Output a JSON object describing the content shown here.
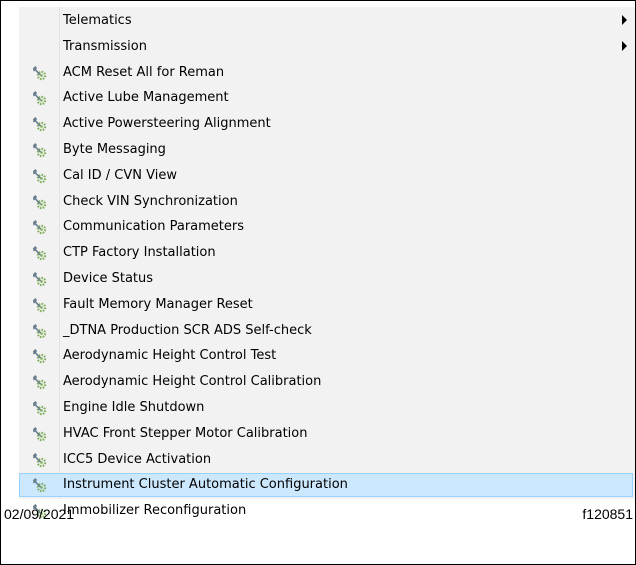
{
  "menu": {
    "items": [
      {
        "label": "Telematics",
        "has_submenu": true,
        "icon": "none",
        "selected": false
      },
      {
        "label": "Transmission",
        "has_submenu": true,
        "icon": "none",
        "selected": false
      },
      {
        "label": "ACM Reset All for Reman",
        "has_submenu": false,
        "icon": "wrench-gear-icon",
        "selected": false
      },
      {
        "label": "Active Lube Management",
        "has_submenu": false,
        "icon": "wrench-gear-icon",
        "selected": false
      },
      {
        "label": "Active Powersteering Alignment",
        "has_submenu": false,
        "icon": "wrench-gear-icon",
        "selected": false
      },
      {
        "label": "Byte Messaging",
        "has_submenu": false,
        "icon": "wrench-gear-icon",
        "selected": false
      },
      {
        "label": "Cal ID / CVN View",
        "has_submenu": false,
        "icon": "wrench-gear-icon",
        "selected": false
      },
      {
        "label": "Check VIN Synchronization",
        "has_submenu": false,
        "icon": "wrench-gear-icon",
        "selected": false
      },
      {
        "label": "Communication Parameters",
        "has_submenu": false,
        "icon": "wrench-gear-icon",
        "selected": false
      },
      {
        "label": "CTP Factory Installation",
        "has_submenu": false,
        "icon": "wrench-gear-icon",
        "selected": false
      },
      {
        "label": "Device Status",
        "has_submenu": false,
        "icon": "wrench-gear-icon",
        "selected": false
      },
      {
        "label": "Fault Memory Manager Reset",
        "has_submenu": false,
        "icon": "wrench-gear-icon",
        "selected": false
      },
      {
        "label": "_DTNA Production SCR ADS Self-check",
        "has_submenu": false,
        "icon": "wrench-gear-icon",
        "selected": false
      },
      {
        "label": "Aerodynamic Height Control Test",
        "has_submenu": false,
        "icon": "wrench-gear-icon",
        "selected": false
      },
      {
        "label": "Aerodynamic Height Control Calibration",
        "has_submenu": false,
        "icon": "wrench-gear-icon",
        "selected": false
      },
      {
        "label": "Engine Idle Shutdown",
        "has_submenu": false,
        "icon": "wrench-gear-icon",
        "selected": false
      },
      {
        "label": "HVAC Front Stepper Motor Calibration",
        "has_submenu": false,
        "icon": "wrench-gear-icon",
        "selected": false
      },
      {
        "label": "ICC5 Device Activation",
        "has_submenu": false,
        "icon": "wrench-gear-icon",
        "selected": false
      },
      {
        "label": "Instrument Cluster Automatic Configuration",
        "has_submenu": false,
        "icon": "wrench-gear-icon",
        "selected": true
      },
      {
        "label": "Immobilizer Reconfiguration",
        "has_submenu": false,
        "icon": "wrench-gear-icon",
        "selected": false
      }
    ]
  },
  "footer": {
    "date": "02/09/2021",
    "figure_id": "f120851"
  },
  "colors": {
    "menu_background": "#f2f2f2",
    "selected_background": "#cce8ff",
    "selected_border": "#99d1ff",
    "icon_wrench": "#6b7f8f",
    "icon_gear": "#7fae5a"
  }
}
